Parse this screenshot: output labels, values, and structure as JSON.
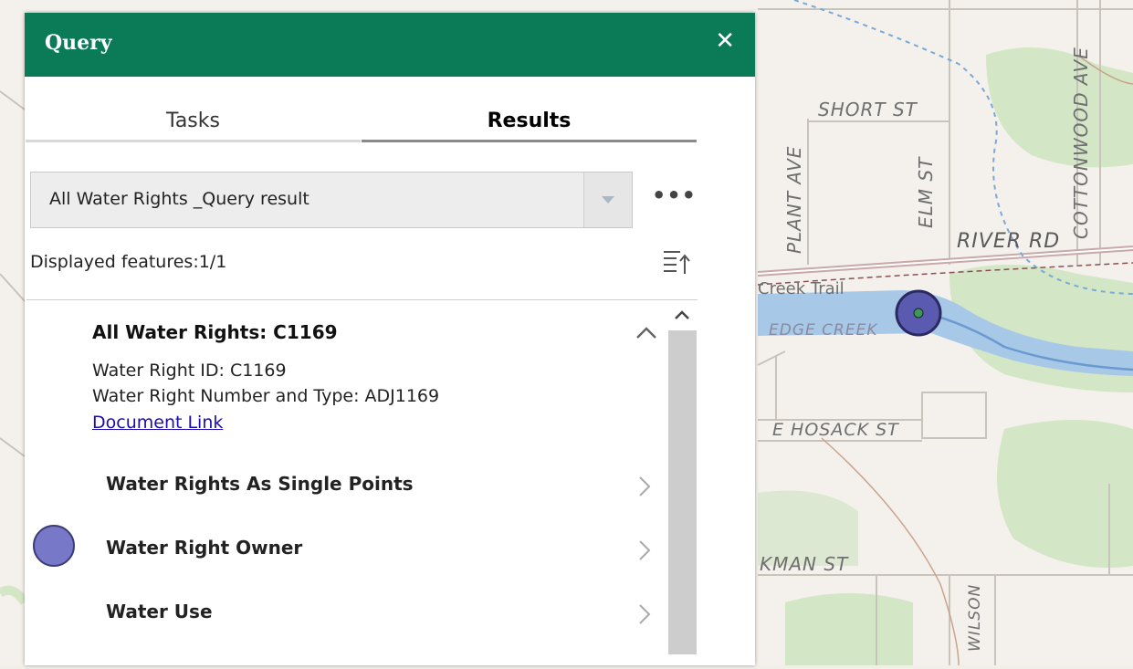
{
  "map": {
    "street_labels": [
      "SHORT ST",
      "PLANT AVE",
      "ELM ST",
      "COTTONWOOD AVE",
      "RIVER RD",
      "Creek Trail",
      "EDGE CREEK",
      "E HOSACK ST",
      "KMAN ST",
      "WILSON"
    ]
  },
  "panel": {
    "title": "Query",
    "close_label": "✕",
    "tabs": [
      {
        "label": "Tasks",
        "active": false
      },
      {
        "label": "Results",
        "active": true
      }
    ],
    "layer_select": {
      "value": "All Water Rights _Query result"
    },
    "more_label": "•••",
    "displayed_features": "Displayed features:1/1",
    "feature": {
      "title": "All Water Rights: C1169",
      "water_right_id": "Water Right ID: C1169",
      "number_and_type": "Water Right Number and Type: ADJ1169",
      "document_link": "Document Link"
    },
    "related": [
      {
        "label": "Water Rights As Single Points"
      },
      {
        "label": "Water Right Owner"
      },
      {
        "label": "Water Use"
      }
    ]
  },
  "colors": {
    "header": "#0b7a57",
    "point_fill": "#7878c8",
    "point_stroke": "#3c3c78",
    "water": "#a8c8e8",
    "park": "#d3e6c5"
  }
}
